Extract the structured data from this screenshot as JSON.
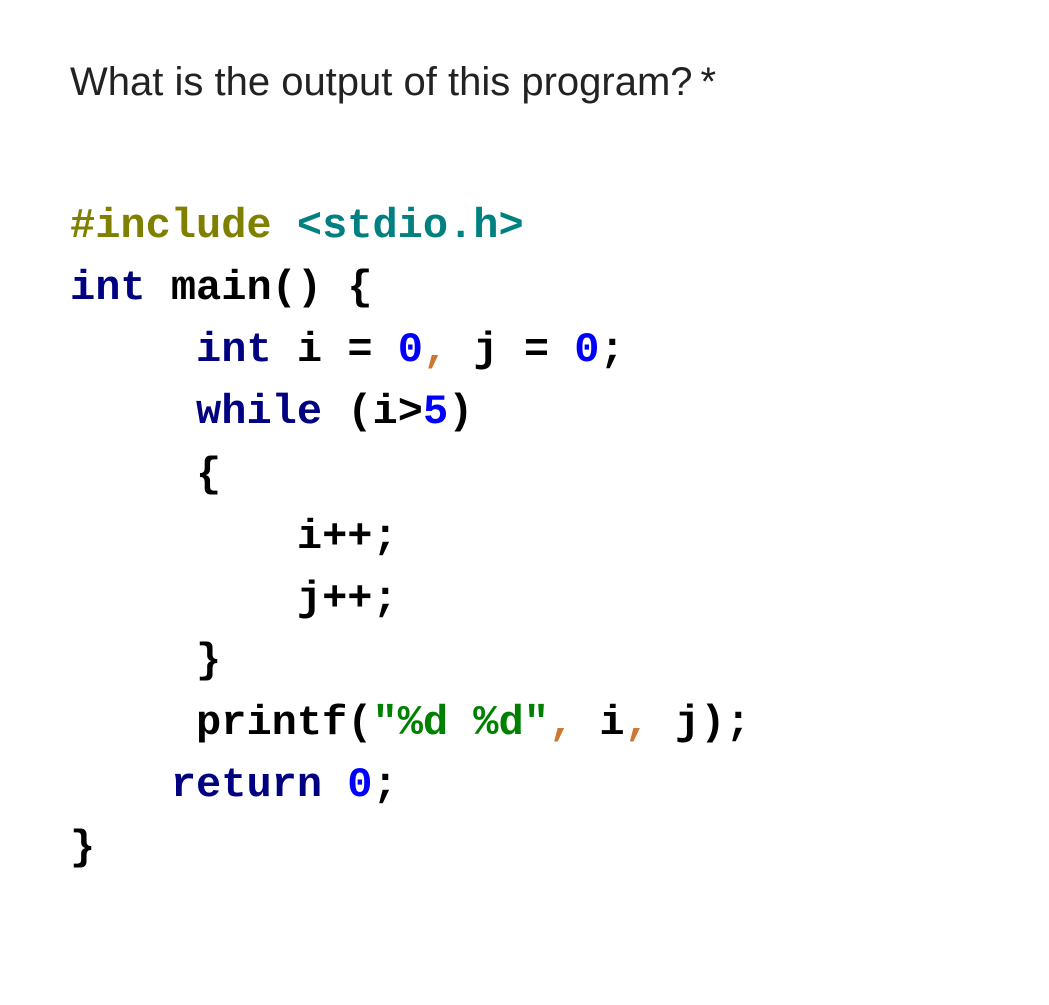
{
  "question": "What is the output of this program?",
  "required_mark": "*",
  "code": {
    "line1": {
      "include": "#include",
      "open": " <",
      "hdr": "stdio.h",
      "close": ">"
    },
    "line2": {
      "kw_int": "int",
      "sp1": " ",
      "main": "main",
      "parens": "()",
      "sp2": " ",
      "brace": "{"
    },
    "line3": {
      "indent": "     ",
      "kw_int": "int",
      "sp1": " ",
      "i": "i",
      "sp2": " ",
      "eq1": "=",
      "sp3": " ",
      "zero1": "0",
      "comma": ",",
      "sp4": " ",
      "j": "j",
      "sp5": " ",
      "eq2": "=",
      "sp6": " ",
      "zero2": "0",
      "semi": ";"
    },
    "line4": {
      "indent": "     ",
      "kw_while": "while",
      "sp1": " ",
      "open": "(",
      "i": "i",
      "gt": ">",
      "five": "5",
      "close": ")"
    },
    "line5": {
      "indent": "     ",
      "brace": "{"
    },
    "line6": {
      "indent": "         ",
      "i": "i",
      "inc": "++",
      "semi": ";"
    },
    "line7": {
      "indent": "         ",
      "j": "j",
      "inc": "++",
      "semi": ";"
    },
    "line8": {
      "indent": "     ",
      "brace": "}"
    },
    "line9": {
      "indent": "     ",
      "fn": "printf",
      "open": "(",
      "str": "\"%d %d\"",
      "comma1": ",",
      "sp1": " ",
      "i": "i",
      "comma2": ",",
      "sp2": " ",
      "j": "j",
      "close": ")",
      "semi": ";"
    },
    "line10": {
      "indent": "    ",
      "kw_return": "return",
      "sp1": " ",
      "zero": "0",
      "semi": ";"
    },
    "line11": {
      "brace": "}"
    }
  }
}
